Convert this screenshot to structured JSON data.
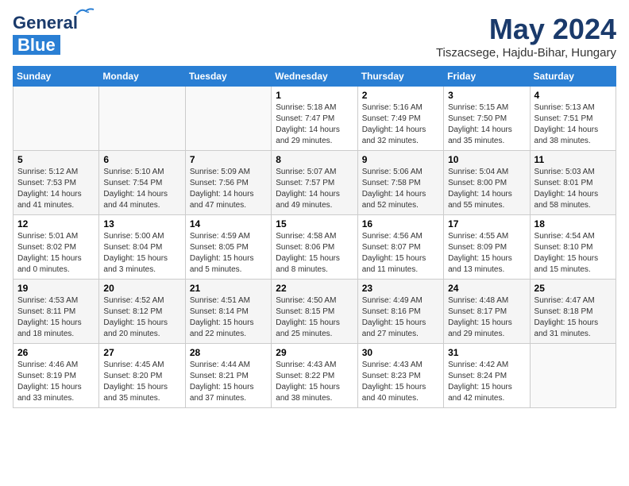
{
  "logo": {
    "line1": "General",
    "line2": "Blue"
  },
  "title": "May 2024",
  "subtitle": "Tiszacsege, Hajdu-Bihar, Hungary",
  "days_header": [
    "Sunday",
    "Monday",
    "Tuesday",
    "Wednesday",
    "Thursday",
    "Friday",
    "Saturday"
  ],
  "weeks": [
    [
      {
        "day": "",
        "info": ""
      },
      {
        "day": "",
        "info": ""
      },
      {
        "day": "",
        "info": ""
      },
      {
        "day": "1",
        "info": "Sunrise: 5:18 AM\nSunset: 7:47 PM\nDaylight: 14 hours\nand 29 minutes."
      },
      {
        "day": "2",
        "info": "Sunrise: 5:16 AM\nSunset: 7:49 PM\nDaylight: 14 hours\nand 32 minutes."
      },
      {
        "day": "3",
        "info": "Sunrise: 5:15 AM\nSunset: 7:50 PM\nDaylight: 14 hours\nand 35 minutes."
      },
      {
        "day": "4",
        "info": "Sunrise: 5:13 AM\nSunset: 7:51 PM\nDaylight: 14 hours\nand 38 minutes."
      }
    ],
    [
      {
        "day": "5",
        "info": "Sunrise: 5:12 AM\nSunset: 7:53 PM\nDaylight: 14 hours\nand 41 minutes."
      },
      {
        "day": "6",
        "info": "Sunrise: 5:10 AM\nSunset: 7:54 PM\nDaylight: 14 hours\nand 44 minutes."
      },
      {
        "day": "7",
        "info": "Sunrise: 5:09 AM\nSunset: 7:56 PM\nDaylight: 14 hours\nand 47 minutes."
      },
      {
        "day": "8",
        "info": "Sunrise: 5:07 AM\nSunset: 7:57 PM\nDaylight: 14 hours\nand 49 minutes."
      },
      {
        "day": "9",
        "info": "Sunrise: 5:06 AM\nSunset: 7:58 PM\nDaylight: 14 hours\nand 52 minutes."
      },
      {
        "day": "10",
        "info": "Sunrise: 5:04 AM\nSunset: 8:00 PM\nDaylight: 14 hours\nand 55 minutes."
      },
      {
        "day": "11",
        "info": "Sunrise: 5:03 AM\nSunset: 8:01 PM\nDaylight: 14 hours\nand 58 minutes."
      }
    ],
    [
      {
        "day": "12",
        "info": "Sunrise: 5:01 AM\nSunset: 8:02 PM\nDaylight: 15 hours\nand 0 minutes."
      },
      {
        "day": "13",
        "info": "Sunrise: 5:00 AM\nSunset: 8:04 PM\nDaylight: 15 hours\nand 3 minutes."
      },
      {
        "day": "14",
        "info": "Sunrise: 4:59 AM\nSunset: 8:05 PM\nDaylight: 15 hours\nand 5 minutes."
      },
      {
        "day": "15",
        "info": "Sunrise: 4:58 AM\nSunset: 8:06 PM\nDaylight: 15 hours\nand 8 minutes."
      },
      {
        "day": "16",
        "info": "Sunrise: 4:56 AM\nSunset: 8:07 PM\nDaylight: 15 hours\nand 11 minutes."
      },
      {
        "day": "17",
        "info": "Sunrise: 4:55 AM\nSunset: 8:09 PM\nDaylight: 15 hours\nand 13 minutes."
      },
      {
        "day": "18",
        "info": "Sunrise: 4:54 AM\nSunset: 8:10 PM\nDaylight: 15 hours\nand 15 minutes."
      }
    ],
    [
      {
        "day": "19",
        "info": "Sunrise: 4:53 AM\nSunset: 8:11 PM\nDaylight: 15 hours\nand 18 minutes."
      },
      {
        "day": "20",
        "info": "Sunrise: 4:52 AM\nSunset: 8:12 PM\nDaylight: 15 hours\nand 20 minutes."
      },
      {
        "day": "21",
        "info": "Sunrise: 4:51 AM\nSunset: 8:14 PM\nDaylight: 15 hours\nand 22 minutes."
      },
      {
        "day": "22",
        "info": "Sunrise: 4:50 AM\nSunset: 8:15 PM\nDaylight: 15 hours\nand 25 minutes."
      },
      {
        "day": "23",
        "info": "Sunrise: 4:49 AM\nSunset: 8:16 PM\nDaylight: 15 hours\nand 27 minutes."
      },
      {
        "day": "24",
        "info": "Sunrise: 4:48 AM\nSunset: 8:17 PM\nDaylight: 15 hours\nand 29 minutes."
      },
      {
        "day": "25",
        "info": "Sunrise: 4:47 AM\nSunset: 8:18 PM\nDaylight: 15 hours\nand 31 minutes."
      }
    ],
    [
      {
        "day": "26",
        "info": "Sunrise: 4:46 AM\nSunset: 8:19 PM\nDaylight: 15 hours\nand 33 minutes."
      },
      {
        "day": "27",
        "info": "Sunrise: 4:45 AM\nSunset: 8:20 PM\nDaylight: 15 hours\nand 35 minutes."
      },
      {
        "day": "28",
        "info": "Sunrise: 4:44 AM\nSunset: 8:21 PM\nDaylight: 15 hours\nand 37 minutes."
      },
      {
        "day": "29",
        "info": "Sunrise: 4:43 AM\nSunset: 8:22 PM\nDaylight: 15 hours\nand 38 minutes."
      },
      {
        "day": "30",
        "info": "Sunrise: 4:43 AM\nSunset: 8:23 PM\nDaylight: 15 hours\nand 40 minutes."
      },
      {
        "day": "31",
        "info": "Sunrise: 4:42 AM\nSunset: 8:24 PM\nDaylight: 15 hours\nand 42 minutes."
      },
      {
        "day": "",
        "info": ""
      }
    ]
  ]
}
